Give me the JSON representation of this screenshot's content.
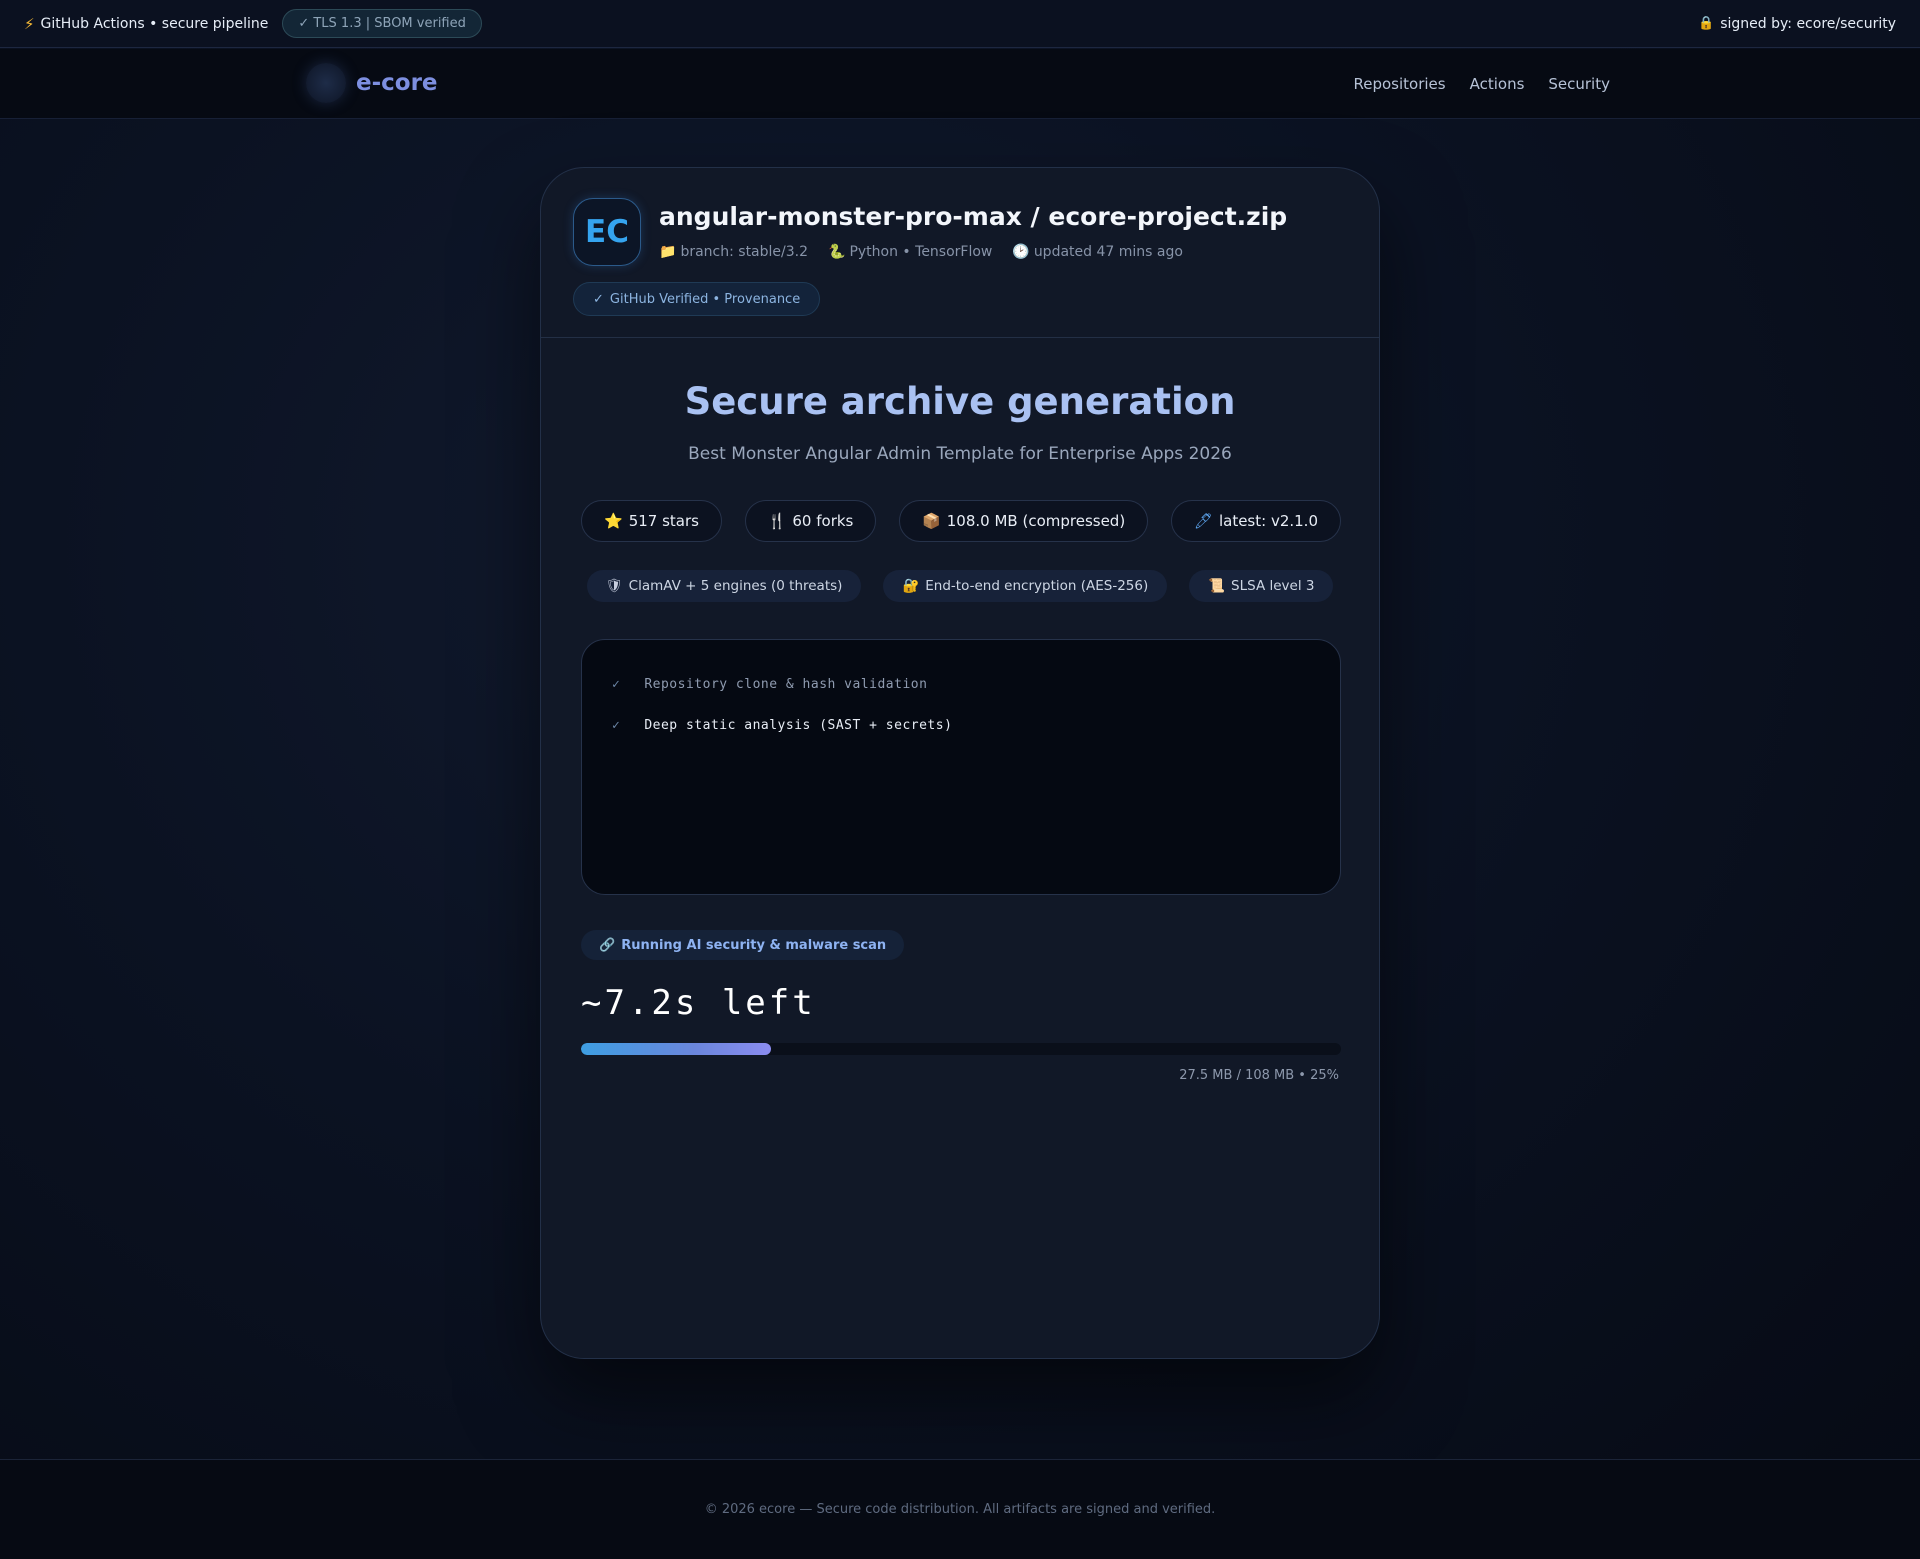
{
  "topbar": {
    "pipeline_icon": "bolt-icon",
    "pipeline": "GitHub Actions • secure pipeline",
    "tls": "✓ TLS 1.3 | SBOM verified",
    "signed_icon": "lock-icon",
    "signed": "signed by: ecore/security"
  },
  "nav": {
    "brand": "e-core",
    "links": [
      "Repositories",
      "Actions",
      "Security"
    ]
  },
  "repo": {
    "avatar": "EC",
    "title": "angular-monster-pro-max / ecore-project.zip",
    "branch": "branch: stable/3.2",
    "lang": "Python • TensorFlow",
    "updated": "updated 47 mins ago",
    "verified": "GitHub Verified • Provenance"
  },
  "main": {
    "headline": "Secure archive generation",
    "subline": "Best Monster Angular Admin Template for Enterprise Apps 2026",
    "stats": [
      {
        "icon": "star-icon",
        "label": "517 stars"
      },
      {
        "icon": "fork-icon",
        "label": "60 forks"
      },
      {
        "icon": "package-icon",
        "label": "108.0 MB (compressed)"
      },
      {
        "icon": "pen-icon",
        "label": "latest: v2.1.0"
      }
    ],
    "tags": [
      {
        "icon": "shield-icon",
        "label": "ClamAV + 5 engines (0 threats)"
      },
      {
        "icon": "key-lock-icon",
        "label": "End-to-end encryption (AES-256)"
      },
      {
        "icon": "scroll-icon",
        "label": "SLSA level 3"
      }
    ],
    "log": [
      {
        "text": "Repository clone & hash validation",
        "state": "done"
      },
      {
        "text": "Deep static analysis (SAST + secrets)",
        "state": "done"
      }
    ],
    "running": "Running AI security & malware scan",
    "time_left": "~7.2s left",
    "progress": {
      "fraction": 0.25,
      "text": "27.5 MB / 108 MB • 25%"
    }
  },
  "footer": "© 2026 ecore — Secure code distribution. All artifacts are signed and verified.",
  "colors": {
    "accent": "#35a4ef",
    "brand": "#7d8fe0",
    "headline": "#a9c1f2"
  }
}
